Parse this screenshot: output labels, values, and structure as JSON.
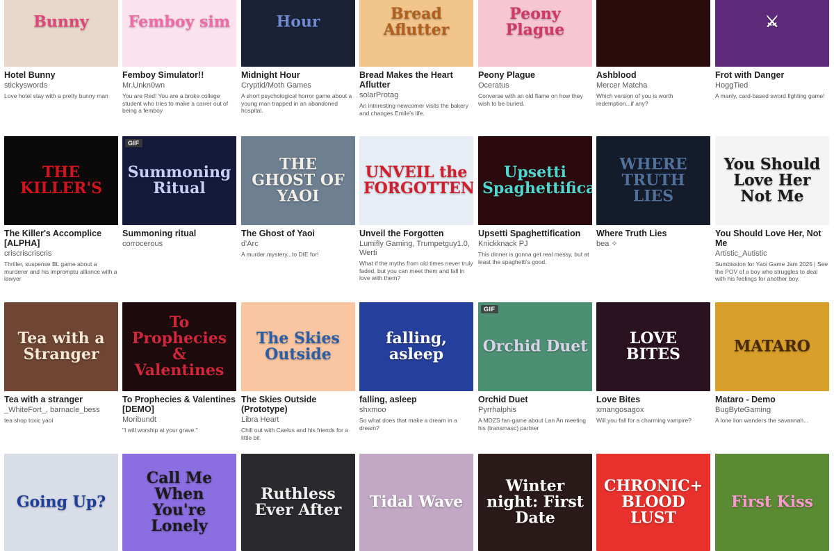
{
  "games": [
    {
      "title": "Hotel Bunny",
      "author": "stickyswords",
      "desc": "Love hotel stay with a pretty bunny man",
      "art": "Bunny",
      "bg": "#e9d7c9",
      "fg": "#e0457a"
    },
    {
      "title": "Femboy Simulator!!",
      "author": "Mr.Unkn0wn",
      "desc": "You are Red! You are a broke college student who tries to make a carrer out of being a femboy",
      "art": "Femboy sim",
      "bg": "#fbe3ee",
      "fg": "#f06aa8"
    },
    {
      "title": "Midnight Hour",
      "author": "Cryptid/Moth Games",
      "desc": "A short psychological horror game about a young man trapped in an abandoned hospital.",
      "art": "Hour",
      "bg": "#1b2236",
      "fg": "#6f8bd1"
    },
    {
      "title": "Bread Makes the Heart Aflutter",
      "author": "solarProtag",
      "desc": "An interesting newcomer visits the bakery and changes Emile's life.",
      "art": "Bread Aflutter",
      "bg": "#f1c58c",
      "fg": "#b05f1c"
    },
    {
      "title": "Peony Plague",
      "author": "Oceratus",
      "desc": "Converse with an old flame on how they wish to be buried.",
      "art": "Peony Plague",
      "bg": "#f6c7d3",
      "fg": "#d2376a"
    },
    {
      "title": "Ashblood",
      "author": "Mercer Matcha",
      "desc": "Which version of you is worth redemption...if any?",
      "art": "",
      "bg": "#2b0c0c",
      "fg": "#8a2b2b"
    },
    {
      "title": "Frot with Danger",
      "author": "HoggTied",
      "desc": "A manly, card-based sword fighting game!",
      "art": "⚔",
      "bg": "#5e2b7a",
      "fg": "#ffffff"
    },
    {
      "title": "The Killer's Accomplice [ALPHA]",
      "author": "criscriscriscris",
      "desc": "Thriller, suspense BL game about a murderer and his impromptu alliance with a lawyer",
      "art": "THE KILLER'S",
      "bg": "#0a0a0a",
      "fg": "#d3131b"
    },
    {
      "title": "Summoning ritual",
      "author": "corrocerous",
      "desc": "",
      "art": "Summoning Ritual",
      "bg": "#161a3a",
      "fg": "#c8cff7",
      "gif": true
    },
    {
      "title": "The Ghost of Yaoi",
      "author": "d'Arc",
      "desc": "A murder mystery...to DIE for!",
      "art": "THE GHOST OF YAOI",
      "bg": "#6d7f90",
      "fg": "#f2efe6"
    },
    {
      "title": "Unveil the Forgotten",
      "author": "Lumifly Gaming, Trumpetguy1.0, Werti",
      "desc": "What if the myths from old times never truly faded, but you can meet them and fall in love with them?",
      "art": "UNVEIL the FORGOTTEN",
      "bg": "#e6edf5",
      "fg": "#d21d2c"
    },
    {
      "title": "Upsetti Spaghettification",
      "author": "Knickknack PJ",
      "desc": "This dinner is gonna get real messy, but at least the spaghetti's good.",
      "art": "Upsetti Spaghettification",
      "bg": "#2a0a0c",
      "fg": "#4ed8d1"
    },
    {
      "title": "Where Truth Lies",
      "author": "bea ✧",
      "desc": "",
      "art": "WHERE TRUTH LIES",
      "bg": "#141c2c",
      "fg": "#51709a"
    },
    {
      "title": "You Should Love Her, Not Me",
      "author": "Artistic_Autistic",
      "desc": "Sumbission for Yaoi Game Jam 2025 | See the POV of a boy who struggles to deal with his feelings for another boy.",
      "art": "You Should Love Her Not Me",
      "bg": "#f4f4f4",
      "fg": "#1a1a1a"
    },
    {
      "title": "Tea with a stranger",
      "author": "_WhiteFort_, barnacle_bess",
      "desc": "tea shop toxic yaoi",
      "art": "Tea with a Stranger",
      "bg": "#6f4633",
      "fg": "#f5e8d7"
    },
    {
      "title": "To Prophecies & Valentines [DEMO]",
      "author": "Moribundt",
      "desc": "\"I will worship at your grave.\"",
      "art": "To Prophecies & Valentines",
      "bg": "#1d0b0d",
      "fg": "#d2263a"
    },
    {
      "title": "The Skies Outside (Prototype)",
      "author": "Libra Heart",
      "desc": "Chill out with Caelus and his friends for a little bit",
      "art": "The Skies Outside",
      "bg": "#f9c6a1",
      "fg": "#2a5fa8"
    },
    {
      "title": "falling, asleep",
      "author": "shxmoo",
      "desc": "So what does that make a dream in a dream?",
      "art": "falling, asleep",
      "bg": "#253f9c",
      "fg": "#ffffff"
    },
    {
      "title": "Orchid Duet",
      "author": "Pyrrhalphis",
      "desc": "A MDZS fan-game about Lan An meeting his (transmasc) partner",
      "art": "Orchid Duet",
      "bg": "#4c8f72",
      "fg": "#d9d3ea",
      "gif": true
    },
    {
      "title": "Love Bites",
      "author": "xmangosagox",
      "desc": "Will you fall for a charming vampire?",
      "art": "LOVE BITES",
      "bg": "#2b1220",
      "fg": "#ffffff"
    },
    {
      "title": "Mataro - Demo",
      "author": "BugByteGaming",
      "desc": "A lone lion wanders the savannah...",
      "art": "MATARO",
      "bg": "#d8a02a",
      "fg": "#4a2a0a"
    },
    {
      "title": "",
      "author": "",
      "desc": "",
      "art": "Going Up?",
      "bg": "#d8dde8",
      "fg": "#1d3f9a"
    },
    {
      "title": "",
      "author": "",
      "desc": "",
      "art": "Call Me When You're Lonely",
      "bg": "#8b6ee0",
      "fg": "#1a1a1a"
    },
    {
      "title": "",
      "author": "",
      "desc": "",
      "art": "Ruthless Ever After",
      "bg": "#2a2a2e",
      "fg": "#eeeeee"
    },
    {
      "title": "",
      "author": "",
      "desc": "",
      "art": "Tidal Wave",
      "bg": "#c2a8c4",
      "fg": "#ffffff"
    },
    {
      "title": "",
      "author": "",
      "desc": "",
      "art": "Winter night: First Date",
      "bg": "#2a1a1a",
      "fg": "#ffffff"
    },
    {
      "title": "",
      "author": "",
      "desc": "",
      "art": "CHRONIC+ BLOOD LUST",
      "bg": "#e8312c",
      "fg": "#ffffff"
    },
    {
      "title": "",
      "author": "",
      "desc": "",
      "art": "First Kiss",
      "bg": "#5a8a34",
      "fg": "#ff9ad0"
    }
  ],
  "gif_label": "GIF"
}
